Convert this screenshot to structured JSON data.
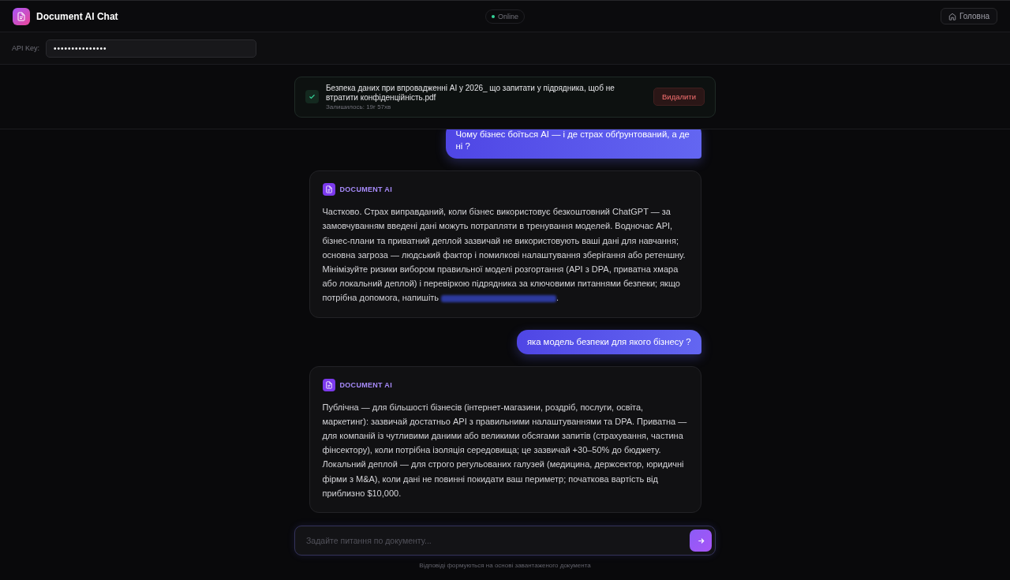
{
  "header": {
    "title": "Document AI Chat",
    "status": "Online",
    "home_button": "Головна"
  },
  "api_key": {
    "label": "API Key:",
    "value": "•••••••••••••••"
  },
  "file": {
    "name": "Безпека даних при впровадженні AI у 2026_ що запитати у підрядника, щоб не втратити конфіденційність.pdf",
    "remaining": "Залишилось: 19г 57хв",
    "uploaded": true,
    "delete_button": "Видалити"
  },
  "messages": [
    {
      "kind": "user",
      "text": "Чому бізнес боїться AI — і де страх обґрунтований, а де ні ?"
    },
    {
      "kind": "assistant",
      "author": "DOCUMENT AI",
      "text": "Частково. Страх виправданий, коли бізнес використовує безкоштовний ChatGPT — за замовчуванням введені дані можуть потрапляти в тренування моделей. Водночас API, бізнес-плани та приватний деплой зазвичай не використовують ваші дані для навчання; основна загроза — людський фактор і помилкові налаштування зберігання або ретеншну. Мінімізуйте ризики вибором правильної моделі розгортання (API з DPA, приватна хмара або локальний деплой) і перевіркою підрядника за ключовими питаннями безпеки; якщо потрібна допомога, напишіть",
      "redacted_link": true,
      "text_end": "."
    },
    {
      "kind": "user",
      "text": "яка модель безпеки для якого бізнесу ?"
    },
    {
      "kind": "assistant",
      "author": "DOCUMENT AI",
      "text": "Публічна — для більшості бізнесів (інтернет-магазини, роздріб, послуги, освіта, маркетинг): зазвичай достатньо API з правильними налаштуваннями та DPA. Приватна — для компаній із чутливими даними або великими обсягами запитів (страхування, частина фінсектору), коли потрібна ізоляція середовища; це зазвичай +30–50% до бюджету. Локальний деплой — для строго регульованих галузей (медицина, держсектор, юридичні фірми з M&A), коли дані не повинні покидати ваш периметр; початкова вартість від приблизно $10,000."
    }
  ],
  "composer": {
    "placeholder": "Задайте питання по документу...",
    "footnote": "Відповіді формуються на основі завантаженого документа"
  }
}
